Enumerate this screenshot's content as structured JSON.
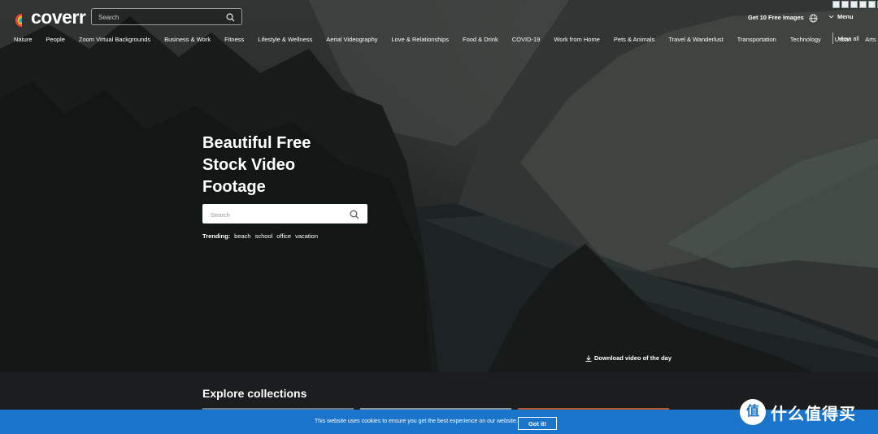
{
  "header": {
    "logo_text": "coverr",
    "search_placeholder": "Search",
    "get_images_label": "Get 10 Free Images",
    "menu_label": "Menu"
  },
  "categories": [
    "Nature",
    "People",
    "Zoom Virtual Backgrounds",
    "Business & Work",
    "Fitness",
    "Lifestyle & Wellness",
    "Aerial Videography",
    "Love & Relationships",
    "Food & Drink",
    "COVID-19",
    "Work from Home",
    "Pets & Animals",
    "Travel & Wanderlust",
    "Transportation",
    "Technology",
    "Urban",
    "Arts & Cr"
  ],
  "view_all_label": "View all",
  "hero": {
    "headline_lines": [
      "Beautiful Free",
      "Stock Video",
      "Footage"
    ],
    "search_placeholder": "Search",
    "trending_label": "Trending:",
    "trending_tags": [
      "beach",
      "school",
      "office",
      "vacation"
    ],
    "download_label": "Download video of the day"
  },
  "collections": {
    "title": "Explore collections"
  },
  "cookie": {
    "text": "This website uses cookies to ensure you get the best experience on our website.",
    "button_label": "Got it!"
  },
  "watermark": {
    "mark": "值",
    "text": "什么值得买"
  },
  "colors": {
    "cookie_bar": "#1a74c9",
    "lower_bg": "#1c1d1f"
  }
}
